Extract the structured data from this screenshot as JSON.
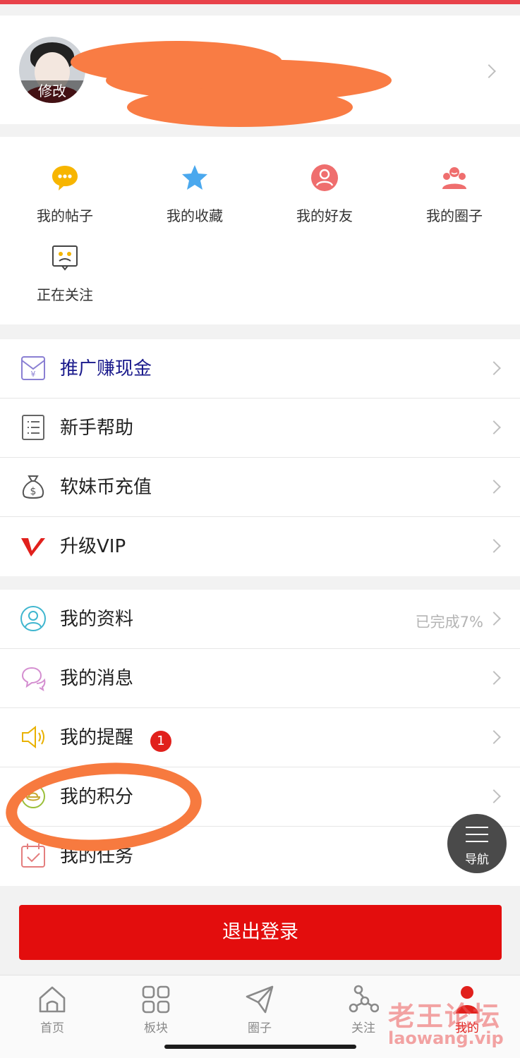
{
  "profile": {
    "avatar_edit": "修改"
  },
  "quick": [
    {
      "label": "我的帖子",
      "icon": "chat-bubble-icon"
    },
    {
      "label": "我的收藏",
      "icon": "star-icon"
    },
    {
      "label": "我的好友",
      "icon": "friend-icon"
    },
    {
      "label": "我的圈子",
      "icon": "group-icon"
    },
    {
      "label": "正在关注",
      "icon": "follow-icon"
    }
  ],
  "group1": [
    {
      "label": "推广赚现金",
      "icon": "envelope-yen-icon",
      "highlight": true
    },
    {
      "label": "新手帮助",
      "icon": "document-list-icon"
    },
    {
      "label": "软妹币充值",
      "icon": "money-bag-icon"
    },
    {
      "label": "升级VIP",
      "icon": "vip-icon"
    }
  ],
  "group2": [
    {
      "label": "我的资料",
      "value": "已完成7%",
      "icon": "person-icon"
    },
    {
      "label": "我的消息",
      "icon": "message-icon"
    },
    {
      "label": "我的提醒",
      "badge": "1",
      "icon": "speaker-icon"
    },
    {
      "label": "我的积分",
      "icon": "coin-icon"
    },
    {
      "label": "我的任务",
      "icon": "calendar-check-icon"
    }
  ],
  "logout": "退出登录",
  "fab": {
    "label": "导航",
    "icon": "menu-icon"
  },
  "tabs": [
    {
      "label": "首页",
      "icon": "home-icon"
    },
    {
      "label": "板块",
      "icon": "grid-icon"
    },
    {
      "label": "圈子",
      "icon": "paper-plane-icon"
    },
    {
      "label": "关注",
      "icon": "network-icon"
    },
    {
      "label": "我的",
      "icon": "profile-icon",
      "active": true
    }
  ],
  "watermark": {
    "title": "老王论坛",
    "url": "laowang.vip"
  },
  "colors": {
    "accent": "#e1201c",
    "highlight_text": "#1a1a8c",
    "annotation": "#f77a3f"
  }
}
